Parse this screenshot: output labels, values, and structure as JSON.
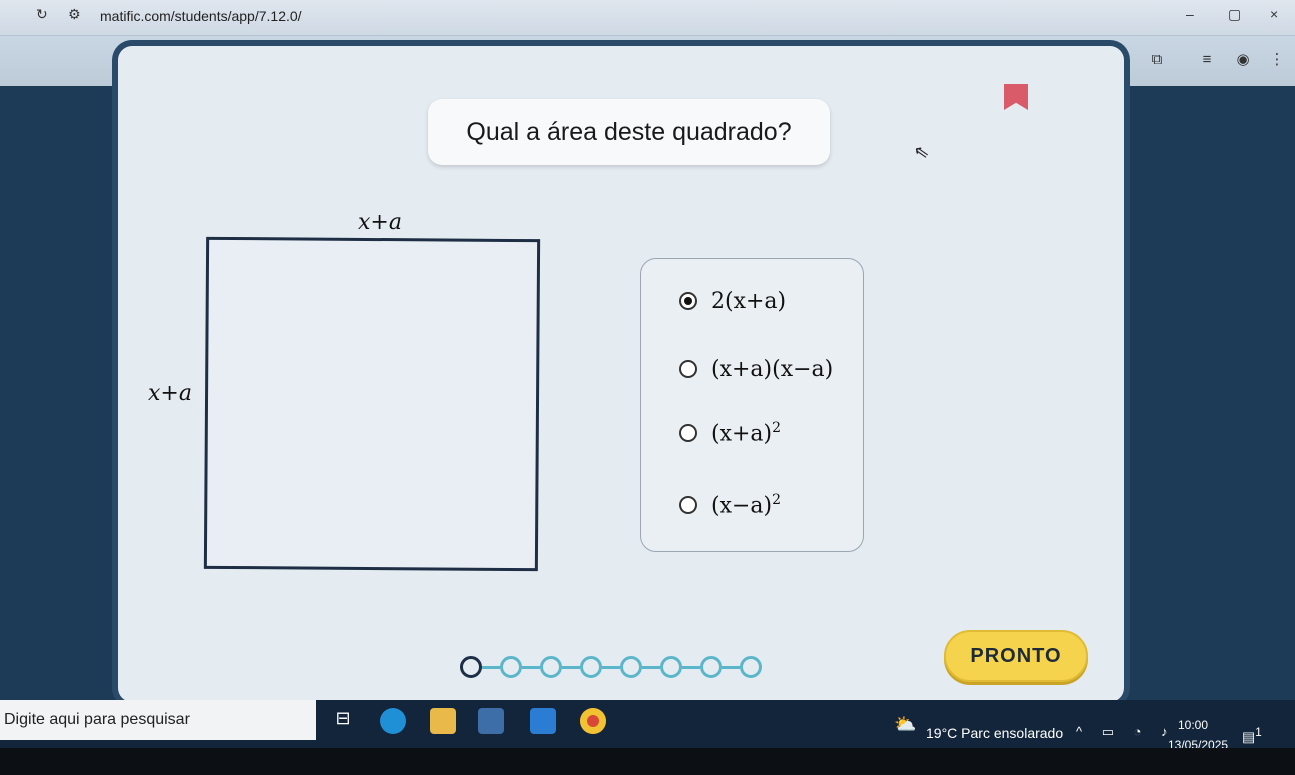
{
  "browser": {
    "url": "matific.com/students/app/7.12.0/",
    "reload_icon": "reload-icon",
    "window_controls": [
      "–",
      "▢",
      "×"
    ]
  },
  "question": {
    "text": "Qual a área deste quadrado?"
  },
  "figure": {
    "top_label": "x+a",
    "side_label": "x+a"
  },
  "options": [
    {
      "base": "2(x+a)",
      "exp": "",
      "selected": true
    },
    {
      "base": "(x+a)(x−a)",
      "exp": "",
      "selected": false
    },
    {
      "base": "(x+a)",
      "exp": "2",
      "selected": false
    },
    {
      "base": "(x−a)",
      "exp": "2",
      "selected": false
    }
  ],
  "progress": {
    "total_steps": 8,
    "current_step": 1
  },
  "actions": {
    "pronto_label": "PRONTO"
  },
  "taskbar": {
    "search_placeholder": "Digite aqui para pesquisar",
    "weather": "19°C  Parc ensolarado",
    "time": "10:00",
    "date": "13/05/2025",
    "notification_count": "1"
  },
  "colors": {
    "accent_yellow": "#f5d34d",
    "progress_teal": "#5bb6c9",
    "bookmark_red": "#d95b6a"
  }
}
